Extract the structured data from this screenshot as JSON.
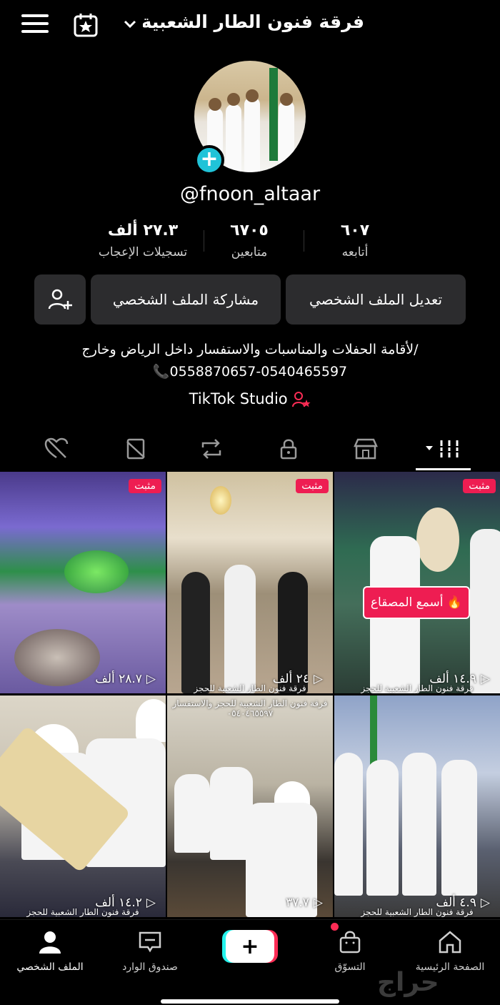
{
  "header": {
    "title": "فرقة فنون الطار الشعبية...",
    "menu_icon": "hamburger-menu-icon",
    "calendar_icon": "calendar-star-icon",
    "dropdown_icon": "chevron-down-icon"
  },
  "profile": {
    "username": "@fnoon_altaar",
    "stats": {
      "likes": {
        "value": "٢٧.٣ ألف",
        "label": "تسجيلات الإعجاب"
      },
      "followers": {
        "value": "٦٧٠٥",
        "label": "متابعين"
      },
      "following": {
        "value": "٦٠٧",
        "label": "أتابعه"
      }
    },
    "buttons": {
      "edit": "تعديل الملف الشخصي",
      "share": "مشاركة الملف الشخصي",
      "add_friend_icon": "add-user-icon"
    },
    "bio": {
      "line1": "لأقامة الحفلات والمناسبات والاستفسار داخل الرياض وخارج/",
      "line2": "📞0558870657-0540465597"
    },
    "studio_link": "TikTok Studio"
  },
  "tabs": [
    "videos",
    "shop",
    "private",
    "reposts",
    "favorites",
    "liked"
  ],
  "videos": [
    {
      "pinned": "مثبت",
      "views": "٢٨.٧ ألف",
      "caption": ""
    },
    {
      "pinned": "مثبت",
      "views": "٢٤ ألف",
      "caption": "فرقة فنون الطار الشعبية للحجز"
    },
    {
      "pinned": "مثبت",
      "views": "١٤.٩ ألف",
      "caption": "فرقة فنون الطار الشعبية للحجز",
      "overlay": "أسمع المصقاع 🔥"
    },
    {
      "pinned": "",
      "views": "١٤.٢ ألف",
      "caption": "فرقة فنون الطار الشعبية للحجز"
    },
    {
      "pinned": "",
      "views": "٣٧.٧",
      "caption": "فرقة فنون الطار الشعبية للحجز والاستفسار ٠٥٤٠٤٦٥٥٩٧"
    },
    {
      "pinned": "",
      "views": "٤.٩ ألف",
      "caption": "فرقة فنون الطار الشعبية للحجز"
    }
  ],
  "bottom_nav": {
    "profile": "الملف الشخصي",
    "inbox": "صندوق الوارد",
    "create": "+",
    "shop": "التسوّق",
    "home": "الصفحة الرئيسية"
  },
  "watermark": "حراج",
  "colors": {
    "accent": "#ee1d52",
    "badge": "#20c3d8",
    "button_bg": "#2c2c2e"
  }
}
